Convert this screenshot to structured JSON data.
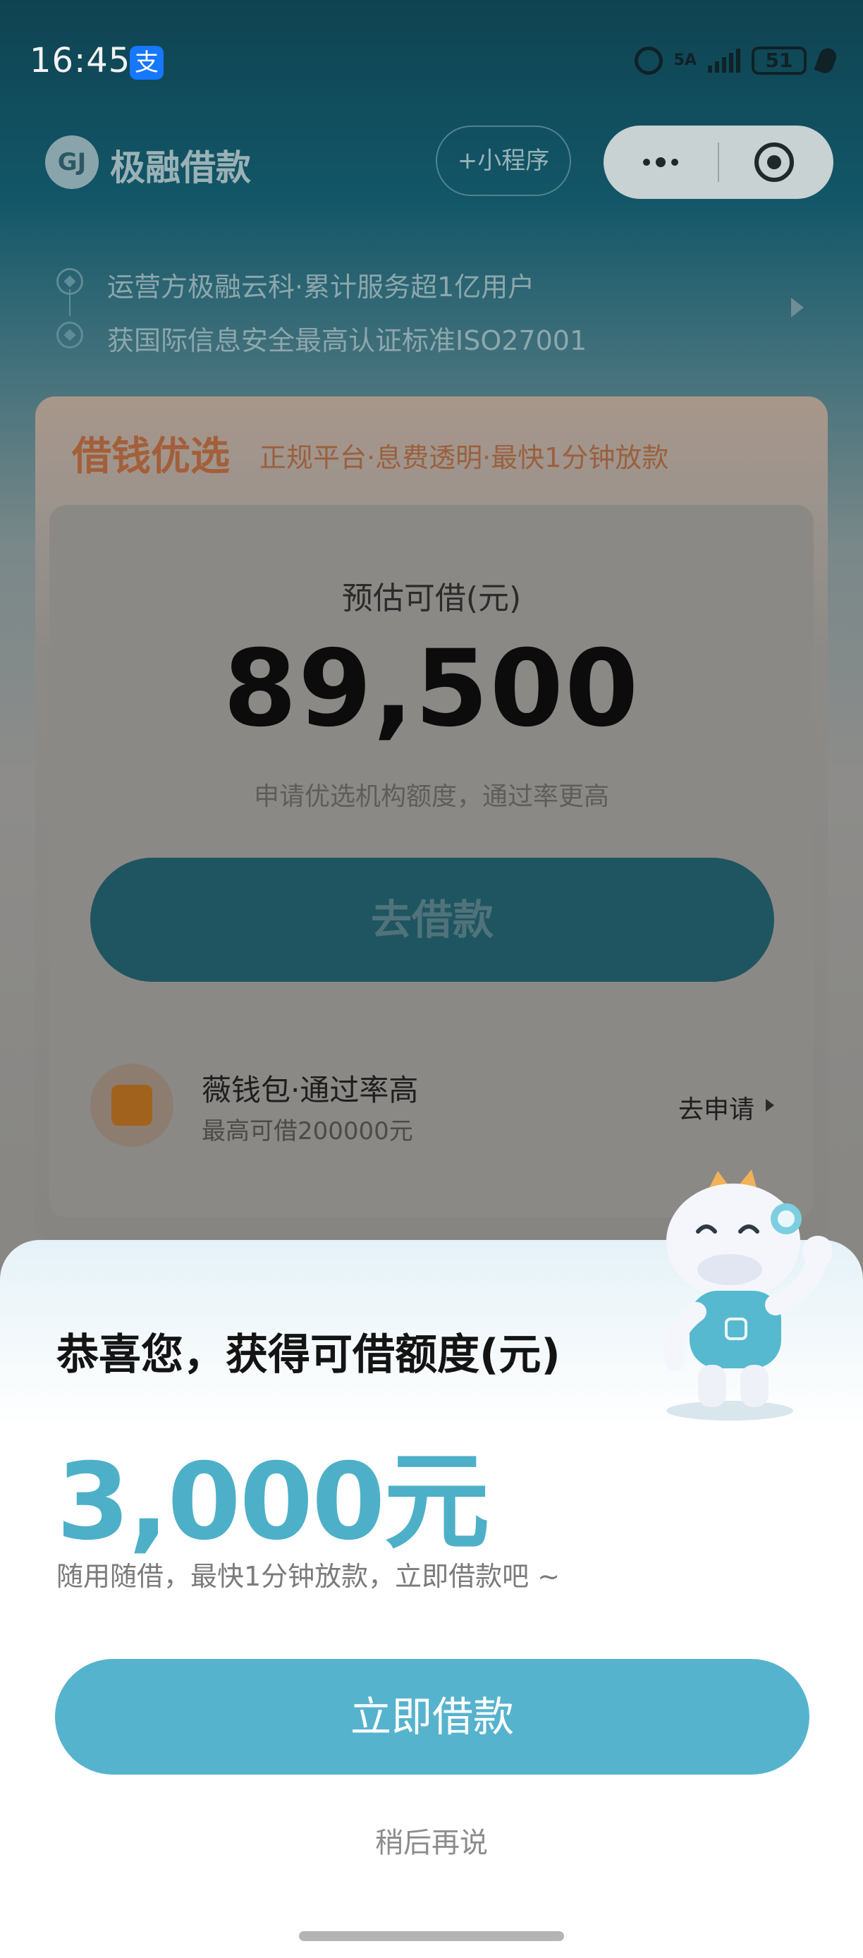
{
  "status_bar": {
    "time": "16:45",
    "app_icon_label": "支",
    "network": "5A",
    "battery": "51"
  },
  "navbar": {
    "logo_text": "GJ",
    "title": "极融借款",
    "add_mini_program": "+小程序"
  },
  "info": {
    "line1": "运营方极融云科·累计服务超1亿用户",
    "line2": "获国际信息安全最高认证标准ISO27001"
  },
  "card": {
    "heading": "借钱优选",
    "subheading": "正规平台·息费透明·最快1分钟放款",
    "estimate_label": "预估可借(元)",
    "estimate_value": "89,500",
    "estimate_note": "申请优选机构额度，通过率更高",
    "go_button": "去借款",
    "product": {
      "name": "薇钱包·通过率高",
      "limit": "最高可借200000元",
      "apply": "去申请"
    }
  },
  "sheet": {
    "title": "恭喜您，获得可借额度(元)",
    "amount": "3,000元",
    "description": "随用随借，最快1分钟放款，立即借款吧 ~",
    "borrow_button": "立即借款",
    "later_link": "稍后再说"
  },
  "colors": {
    "accent": "#56b3cd",
    "amount": "#4db0c8",
    "card_heading": "#a35f3a"
  }
}
